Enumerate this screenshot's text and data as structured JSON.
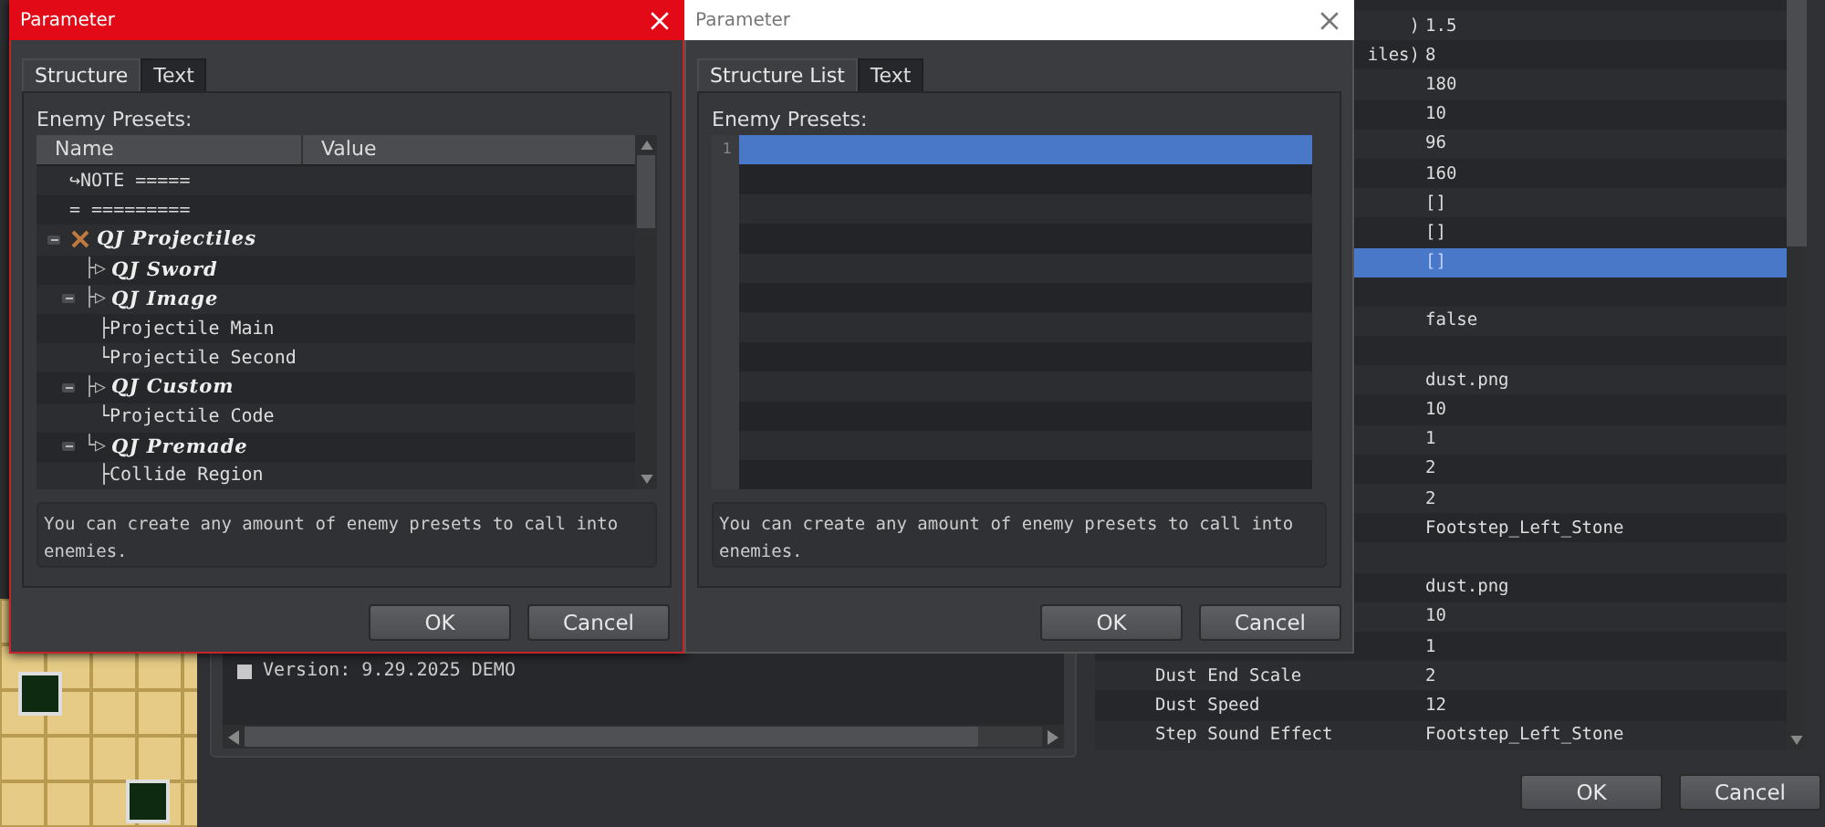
{
  "background_window": {
    "map": {
      "kind": "picture"
    },
    "log": {
      "lines": [
        "Version: 9.29.2025 DEMO"
      ]
    },
    "parameters": {
      "rows": [
        {
          "name": ")",
          "clipped": true,
          "value": "1.5",
          "selected": false
        },
        {
          "name": "iles)",
          "clipped": true,
          "value": "8",
          "selected": false
        },
        {
          "value": "180",
          "selected": false
        },
        {
          "value": "10",
          "selected": false
        },
        {
          "value": "96",
          "selected": false
        },
        {
          "value": "160",
          "selected": false
        },
        {
          "value": "[]",
          "selected": false
        },
        {
          "value": "[]",
          "selected": false
        },
        {
          "value": "[]",
          "selected": true
        },
        {
          "selected": false
        },
        {
          "value": "false",
          "selected": false
        },
        {
          "selected": false
        },
        {
          "value": "dust.png",
          "selected": false
        },
        {
          "value": "10",
          "selected": false
        },
        {
          "value": "1",
          "selected": false
        },
        {
          "value": "2",
          "selected": false
        },
        {
          "value": "2",
          "selected": false
        },
        {
          "value": "Footstep_Left_Stone",
          "selected": false
        },
        {
          "selected": false
        },
        {
          "value": "dust.png",
          "selected": false
        },
        {
          "value": "10",
          "selected": false
        },
        {
          "value": "1",
          "selected": false
        },
        {
          "name": "Dust End Scale",
          "value": "2",
          "selected": false
        },
        {
          "name": "Dust Speed",
          "value": "12",
          "selected": false
        },
        {
          "name": "Step Sound Effect",
          "value": "Footstep_Left_Stone",
          "selected": false
        }
      ]
    },
    "buttons": [
      "OK",
      "Cancel"
    ]
  },
  "dialogs": [
    {
      "title": "Parameter",
      "active": true,
      "tabs": [
        {
          "label": "Structure",
          "selected": true
        },
        {
          "label": "Text",
          "selected": false
        }
      ],
      "label": "Enemy Presets:",
      "kind": "tree",
      "columns": [
        "Name",
        "Value"
      ],
      "rows": [
        {
          "kind": "plain",
          "label": "↪NOTE ====="
        },
        {
          "kind": "plain",
          "label": "= ========="
        },
        {
          "kind": "group",
          "label": "QJ Projectiles",
          "expanded": true,
          "children": [
            {
              "kind": "group",
              "branch": "├▷",
              "label": "QJ Sword"
            },
            {
              "kind": "group",
              "branch": "├▷",
              "label": "QJ Image",
              "expanded": true,
              "children": [
                {
                  "kind": "plain",
                  "label": "├Projectile Main"
                },
                {
                  "kind": "plain",
                  "label": "└Projectile Second"
                }
              ]
            },
            {
              "kind": "group",
              "branch": "├▷",
              "label": "QJ Custom",
              "expanded": true,
              "children": [
                {
                  "kind": "plain",
                  "label": "└Projectile Code"
                }
              ]
            },
            {
              "kind": "group",
              "branch": "└▷",
              "label": "QJ Premade",
              "expanded": true,
              "children": [
                {
                  "kind": "plain",
                  "label": "├Collide Region"
                }
              ]
            }
          ]
        }
      ],
      "description": "You can create any amount of enemy presets to call into enemies.",
      "buttons": [
        "OK",
        "Cancel"
      ]
    },
    {
      "title": "Parameter",
      "active": false,
      "tabs": [
        {
          "label": "Structure List",
          "selected": true
        },
        {
          "label": "Text",
          "selected": false
        }
      ],
      "label": "Enemy Presets:",
      "kind": "list",
      "lines": [
        {
          "number": "1",
          "selected": true
        }
      ],
      "description": "You can create any amount of enemy presets to call into enemies.",
      "buttons": [
        "OK",
        "Cancel"
      ]
    }
  ]
}
